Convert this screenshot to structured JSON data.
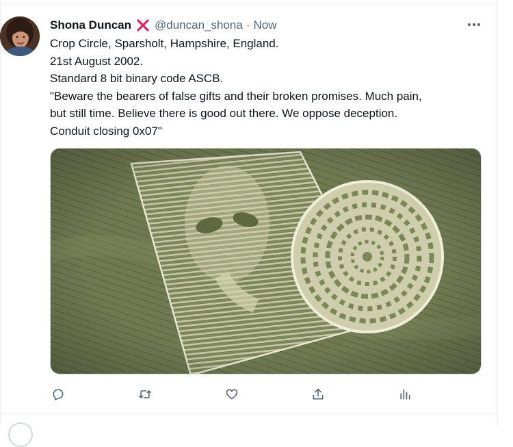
{
  "tweet": {
    "author_name": "Shona Duncan",
    "author_handle": "@duncan_shona",
    "separator": "·",
    "timestamp": "Now",
    "badge_icon": "red-x-icon",
    "more_icon": "more-horizontal-icon",
    "lines": [
      "Crop Circle, Sparsholt, Hampshire, England.",
      "21st August 2002.",
      "Standard 8 bit binary code ASCB.",
      "\"Beware the bearers of false gifts and their broken promises.  Much pain,",
      "but still time.  Believe there is good out there.  We oppose deception.",
      "Conduit closing 0x07\""
    ],
    "actions": [
      {
        "name": "reply-icon"
      },
      {
        "name": "retweet-icon"
      },
      {
        "name": "like-icon"
      },
      {
        "name": "share-icon"
      },
      {
        "name": "analytics-icon"
      }
    ]
  },
  "colors": {
    "text_primary": "#0f1419",
    "text_secondary": "#536471",
    "divider": "#eff3f4",
    "badge_red": "#e0245e",
    "field_green": "#6f7a52"
  }
}
